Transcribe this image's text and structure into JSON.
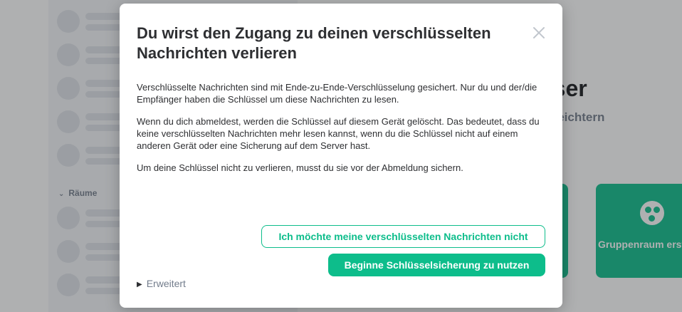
{
  "background": {
    "rooms_heading": "Räume",
    "home_title": "st-user",
    "home_subtitle": "stieg erleichtern",
    "tiles": [
      {
        "label": "",
        "icon": "unknown"
      },
      {
        "label": "Gruppenraum erstellen",
        "icon": "group-icon"
      }
    ]
  },
  "dialog": {
    "title": "Du wirst den Zugang zu deinen verschlüsselten Nachrichten verlieren",
    "close_icon": "close-icon",
    "paragraphs": [
      "Verschlüsselte Nachrichten sind mit Ende-zu-Ende-Verschlüsselung gesichert. Nur du und der/die Empfänger haben die Schlüssel um diese Nachrichten zu lesen.",
      "Wenn du dich abmeldest, werden die Schlüssel auf diesem Gerät gelöscht. Das bedeutet, dass du keine verschlüsselten Nachrichten mehr lesen kannst, wenn du die Schlüssel nicht auf einem anderen Gerät oder eine Sicherung auf dem Server hast.",
      "Um deine Schlüssel nicht zu verlieren, musst du sie vor der Abmeldung sichern."
    ],
    "secondary_button": "Ich möchte meine verschlüsselten Nachrichten nicht",
    "primary_button": "Beginne Schlüsselsicherung zu nutzen",
    "advanced_toggle": "Erweitert"
  },
  "colors": {
    "accent": "#0dbd8b",
    "text": "#2e2f32",
    "muted": "#737d8c"
  }
}
